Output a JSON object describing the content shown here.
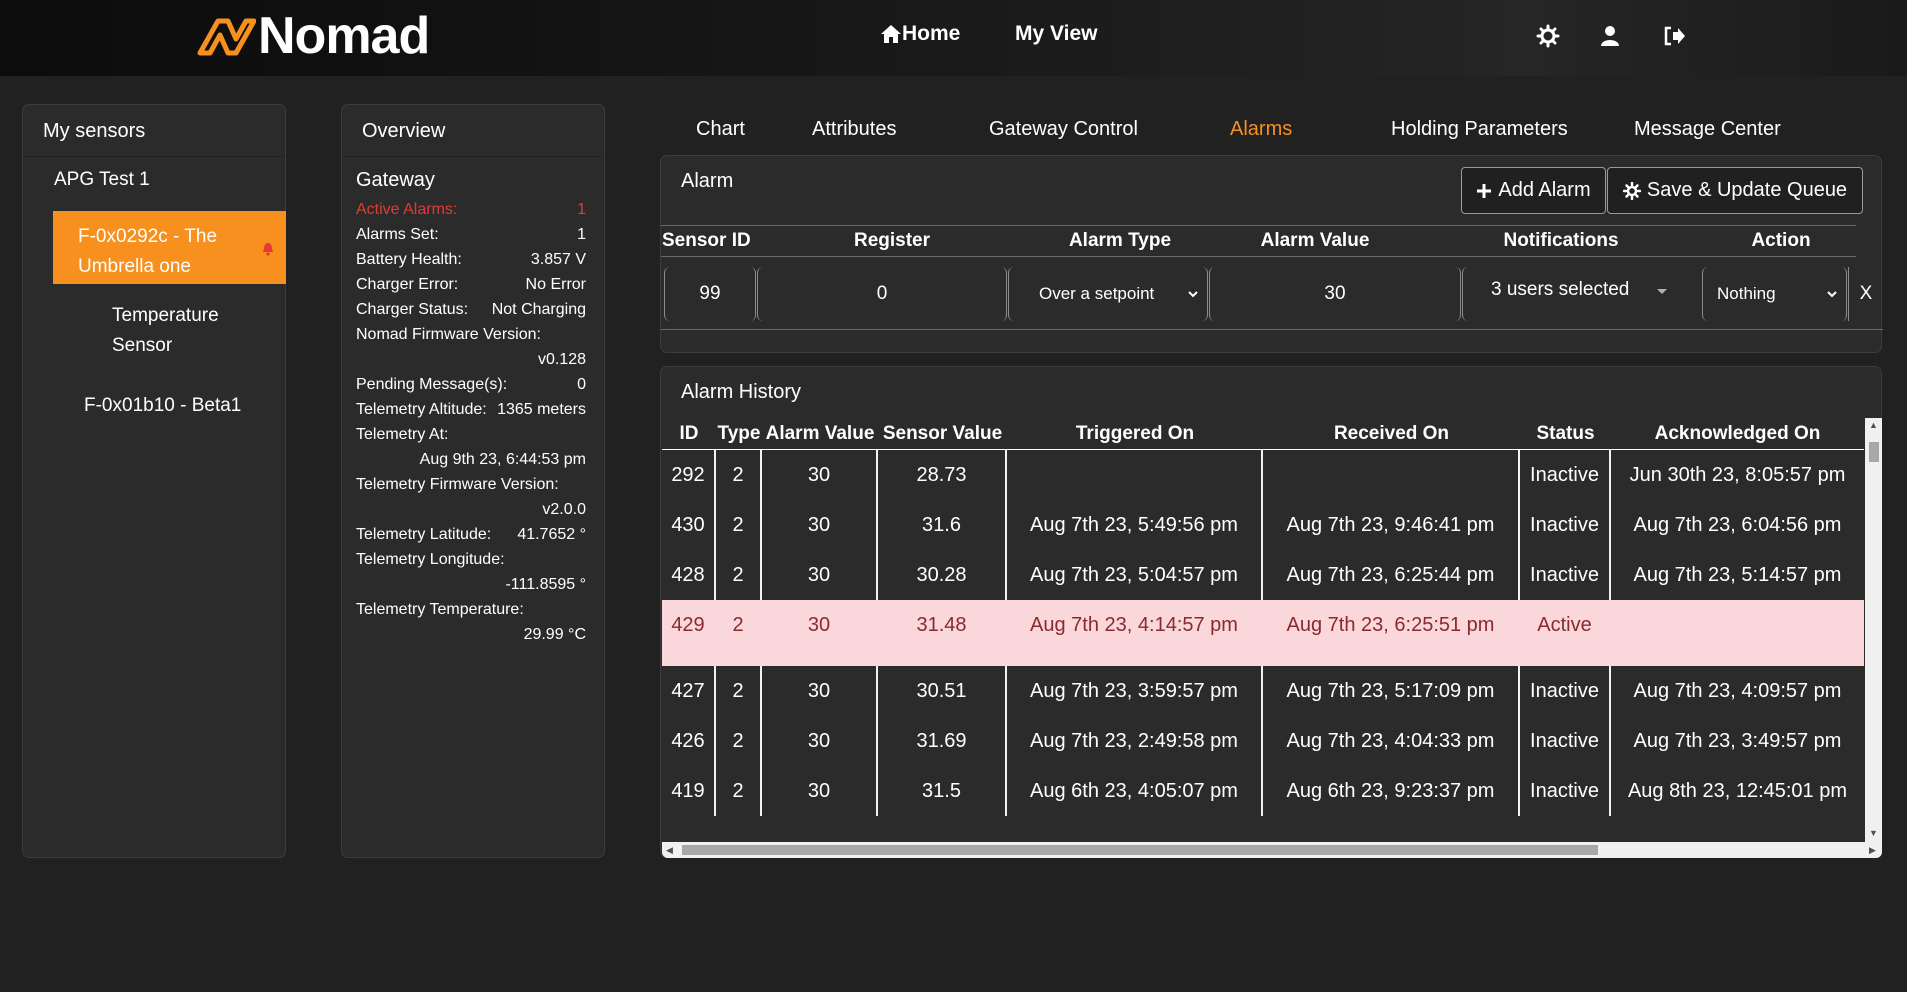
{
  "header": {
    "brand": "Nomad",
    "nav": {
      "home": "Home",
      "my_view": "My View"
    },
    "icons": [
      "logo-mark",
      "home-icon",
      "settings-icon",
      "user-icon",
      "logout-icon"
    ],
    "accent": "#f7901e"
  },
  "sensors": {
    "title": "My sensors",
    "group": "APG Test 1",
    "items": [
      {
        "line1": "F-0x0292c - The",
        "line2": "Umbrella one",
        "selected": true,
        "alarm": true
      },
      {
        "line1": "Temperature",
        "line2": "Sensor"
      },
      {
        "line1": "F-0x01b10 - Beta1"
      }
    ]
  },
  "overview": {
    "title": "Overview",
    "section": "Gateway",
    "active_alarms_label": "Active Alarms:",
    "active_alarms": "1",
    "alarms_set_label": "Alarms Set:",
    "alarms_set": "1",
    "battery_label": "Battery Health:",
    "battery": "3.857 V",
    "charger_error_label": "Charger Error:",
    "charger_error": "No Error",
    "charger_status_label": "Charger Status:",
    "charger_status": "Not Charging",
    "firmware_label": "Nomad Firmware Version:",
    "firmware": "v0.128",
    "pending_label": "Pending Message(s):",
    "pending": "0",
    "altitude_label": "Telemetry Altitude:",
    "altitude": "1365 meters",
    "telemetry_at_label": "Telemetry At:",
    "telemetry_at": "Aug 9th 23, 6:44:53 pm",
    "tele_fw_label": "Telemetry Firmware Version:",
    "tele_fw": "v2.0.0",
    "lat_label": "Telemetry Latitude:",
    "lat": "41.7652 °",
    "lon_label": "Telemetry Longitude:",
    "lon": "-111.8595 °",
    "temp_label": "Telemetry Temperature:",
    "temp": "29.99 °C"
  },
  "tabs": {
    "chart": "Chart",
    "attributes": "Attributes",
    "gateway": "Gateway Control",
    "alarms": "Alarms",
    "holding": "Holding Parameters",
    "messages": "Message Center",
    "active": "alarms"
  },
  "alarm": {
    "title": "Alarm",
    "add_label": "Add Alarm",
    "save_label": "Save & Update Queue",
    "columns": {
      "sensor_id": "Sensor ID",
      "register": "Register",
      "type": "Alarm Type",
      "value": "Alarm Value",
      "notifications": "Notifications",
      "action": "Action"
    },
    "row": {
      "sensor_id": "99",
      "register": "0",
      "type": "Over a setpoint",
      "value": "30",
      "notifications": "3 users selected",
      "action": "Nothing",
      "remove": "X"
    }
  },
  "history": {
    "title": "Alarm History",
    "columns": {
      "id": "ID",
      "type": "Type",
      "alarm_value": "Alarm Value",
      "sensor_value": "Sensor Value",
      "triggered": "Triggered On",
      "received": "Received On",
      "status": "Status",
      "ack": "Acknowledged On"
    },
    "rows": [
      {
        "id": "292",
        "type": "2",
        "alarm_value": "30",
        "sensor_value": "28.73",
        "triggered": "",
        "received": "",
        "status": "Inactive",
        "ack": "Jun 30th 23, 8:05:57 pm"
      },
      {
        "id": "430",
        "type": "2",
        "alarm_value": "30",
        "sensor_value": "31.6",
        "triggered": "Aug 7th 23, 5:49:56 pm",
        "received": "Aug 7th 23, 9:46:41 pm",
        "status": "Inactive",
        "ack": "Aug 7th 23, 6:04:56 pm"
      },
      {
        "id": "428",
        "type": "2",
        "alarm_value": "30",
        "sensor_value": "30.28",
        "triggered": "Aug 7th 23, 5:04:57 pm",
        "received": "Aug 7th 23, 6:25:44 pm",
        "status": "Inactive",
        "ack": "Aug 7th 23, 5:14:57 pm"
      },
      {
        "id": "429",
        "type": "2",
        "alarm_value": "30",
        "sensor_value": "31.48",
        "triggered": "Aug 7th 23, 4:14:57 pm",
        "received": "Aug 7th 23, 6:25:51 pm",
        "status": "Active",
        "ack": ""
      },
      {
        "id": "427",
        "type": "2",
        "alarm_value": "30",
        "sensor_value": "30.51",
        "triggered": "Aug 7th 23, 3:59:57 pm",
        "received": "Aug 7th 23, 5:17:09 pm",
        "status": "Inactive",
        "ack": "Aug 7th 23, 4:09:57 pm"
      },
      {
        "id": "426",
        "type": "2",
        "alarm_value": "30",
        "sensor_value": "31.69",
        "triggered": "Aug 7th 23, 2:49:58 pm",
        "received": "Aug 7th 23, 4:04:33 pm",
        "status": "Inactive",
        "ack": "Aug 7th 23, 3:49:57 pm"
      },
      {
        "id": "419",
        "type": "2",
        "alarm_value": "30",
        "sensor_value": "31.5",
        "triggered": "Aug 6th 23, 4:05:07 pm",
        "received": "Aug 6th 23, 9:23:37 pm",
        "status": "Inactive",
        "ack": "Aug 8th 23, 12:45:01 pm"
      }
    ]
  }
}
